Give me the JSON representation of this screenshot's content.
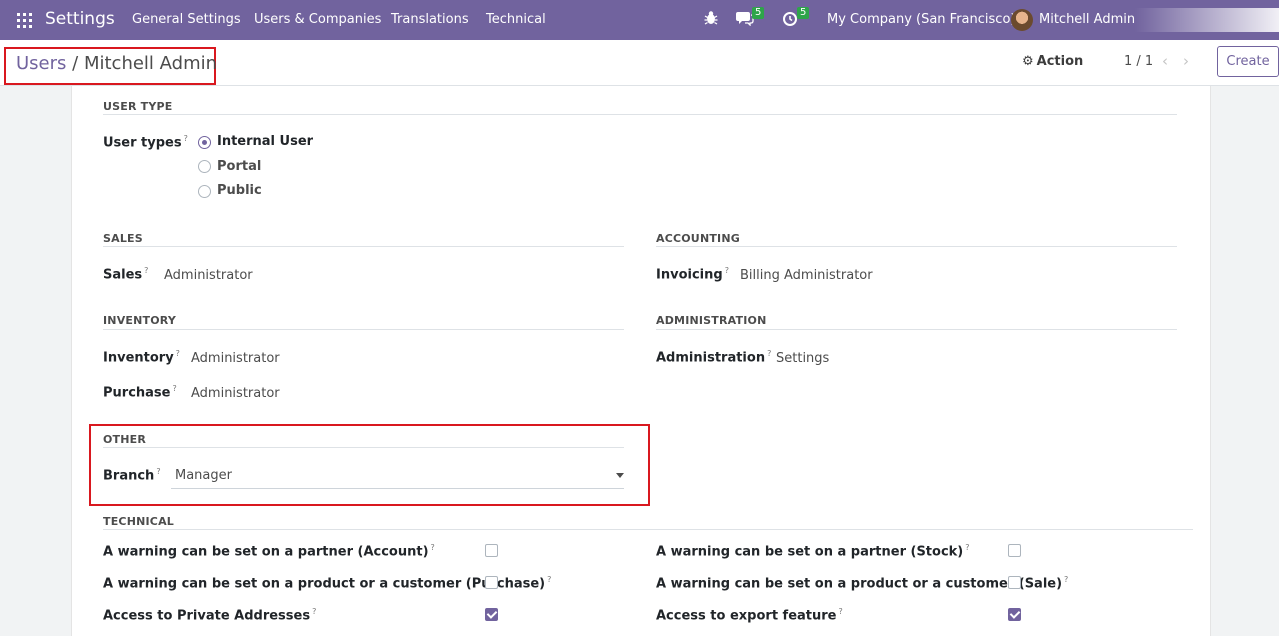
{
  "navbar": {
    "app_title": "Settings",
    "menu": [
      "General Settings",
      "Users & Companies",
      "Translations",
      "Technical"
    ],
    "messages_count": "5",
    "activities_count": "5",
    "company": "My Company (San Francisco)",
    "user": "Mitchell Admin"
  },
  "control": {
    "breadcrumb_parent": "Users",
    "breadcrumb_sep": "/",
    "breadcrumb_current": "Mitchell Admin",
    "action_label": "Action",
    "pager": "1 / 1",
    "create_label": "Create"
  },
  "form": {
    "user_type": {
      "title": "USER TYPE",
      "label": "User types",
      "options": [
        {
          "label": "Internal User",
          "checked": true
        },
        {
          "label": "Portal",
          "checked": false
        },
        {
          "label": "Public",
          "checked": false
        }
      ]
    },
    "sales": {
      "title": "SALES",
      "label": "Sales",
      "value": "Administrator"
    },
    "accounting": {
      "title": "ACCOUNTING",
      "label": "Invoicing",
      "value": "Billing Administrator"
    },
    "inventory": {
      "title": "INVENTORY",
      "fields": [
        {
          "label": "Inventory",
          "value": "Administrator"
        },
        {
          "label": "Purchase",
          "value": "Administrator"
        }
      ]
    },
    "administration": {
      "title": "ADMINISTRATION",
      "label": "Administration",
      "value": "Settings"
    },
    "other": {
      "title": "OTHER",
      "label": "Branch",
      "value": "Manager"
    },
    "technical": {
      "title": "TECHNICAL",
      "left": [
        {
          "label": "A warning can be set on a partner (Account)",
          "checked": false
        },
        {
          "label": "A warning can be set on a product or a customer (Purchase)",
          "checked": false
        },
        {
          "label": "Access to Private Addresses",
          "checked": true
        }
      ],
      "right": [
        {
          "label": "A warning can be set on a partner (Stock)",
          "checked": false
        },
        {
          "label": "A warning can be set on a product or a customer (Sale)",
          "checked": false
        },
        {
          "label": "Access to export feature",
          "checked": true
        }
      ]
    },
    "help_mark": "?"
  }
}
